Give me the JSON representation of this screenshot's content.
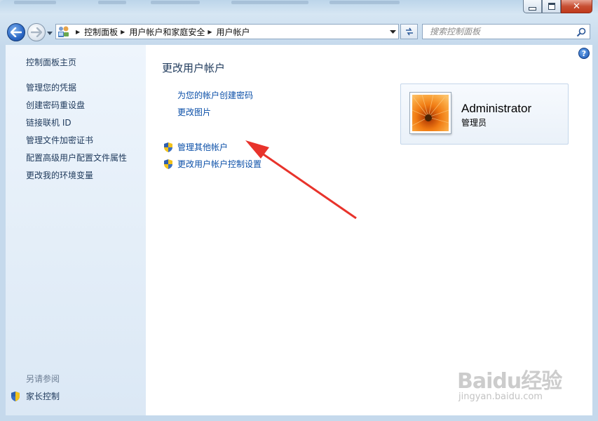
{
  "window": {
    "colors": {
      "sidebar_link": "#1e395b",
      "task_link": "#0b4fa8",
      "title": "#1e395b",
      "close_red": "#c74f33"
    }
  },
  "address": {
    "crumbs": [
      "控制面板",
      "用户帐户和家庭安全",
      "用户帐户"
    ]
  },
  "search": {
    "placeholder": "搜索控制面板"
  },
  "sidebar": {
    "home": "控制面板主页",
    "items": [
      "管理您的凭据",
      "创建密码重设盘",
      "链接联机 ID",
      "管理文件加密证书",
      "配置高级用户配置文件属性",
      "更改我的环境变量"
    ],
    "see_also": "另请参阅",
    "parental_controls": "家长控制"
  },
  "main": {
    "title": "更改用户帐户",
    "tasks": [
      "为您的帐户创建密码",
      "更改图片"
    ],
    "shield_tasks": [
      "管理其他帐户",
      "更改用户帐户控制设置"
    ]
  },
  "user": {
    "name": "Administrator",
    "role": "管理员"
  },
  "help": {
    "label": "?"
  },
  "watermark": {
    "logo": "Baidu经验",
    "url": "jingyan.baidu.com"
  }
}
